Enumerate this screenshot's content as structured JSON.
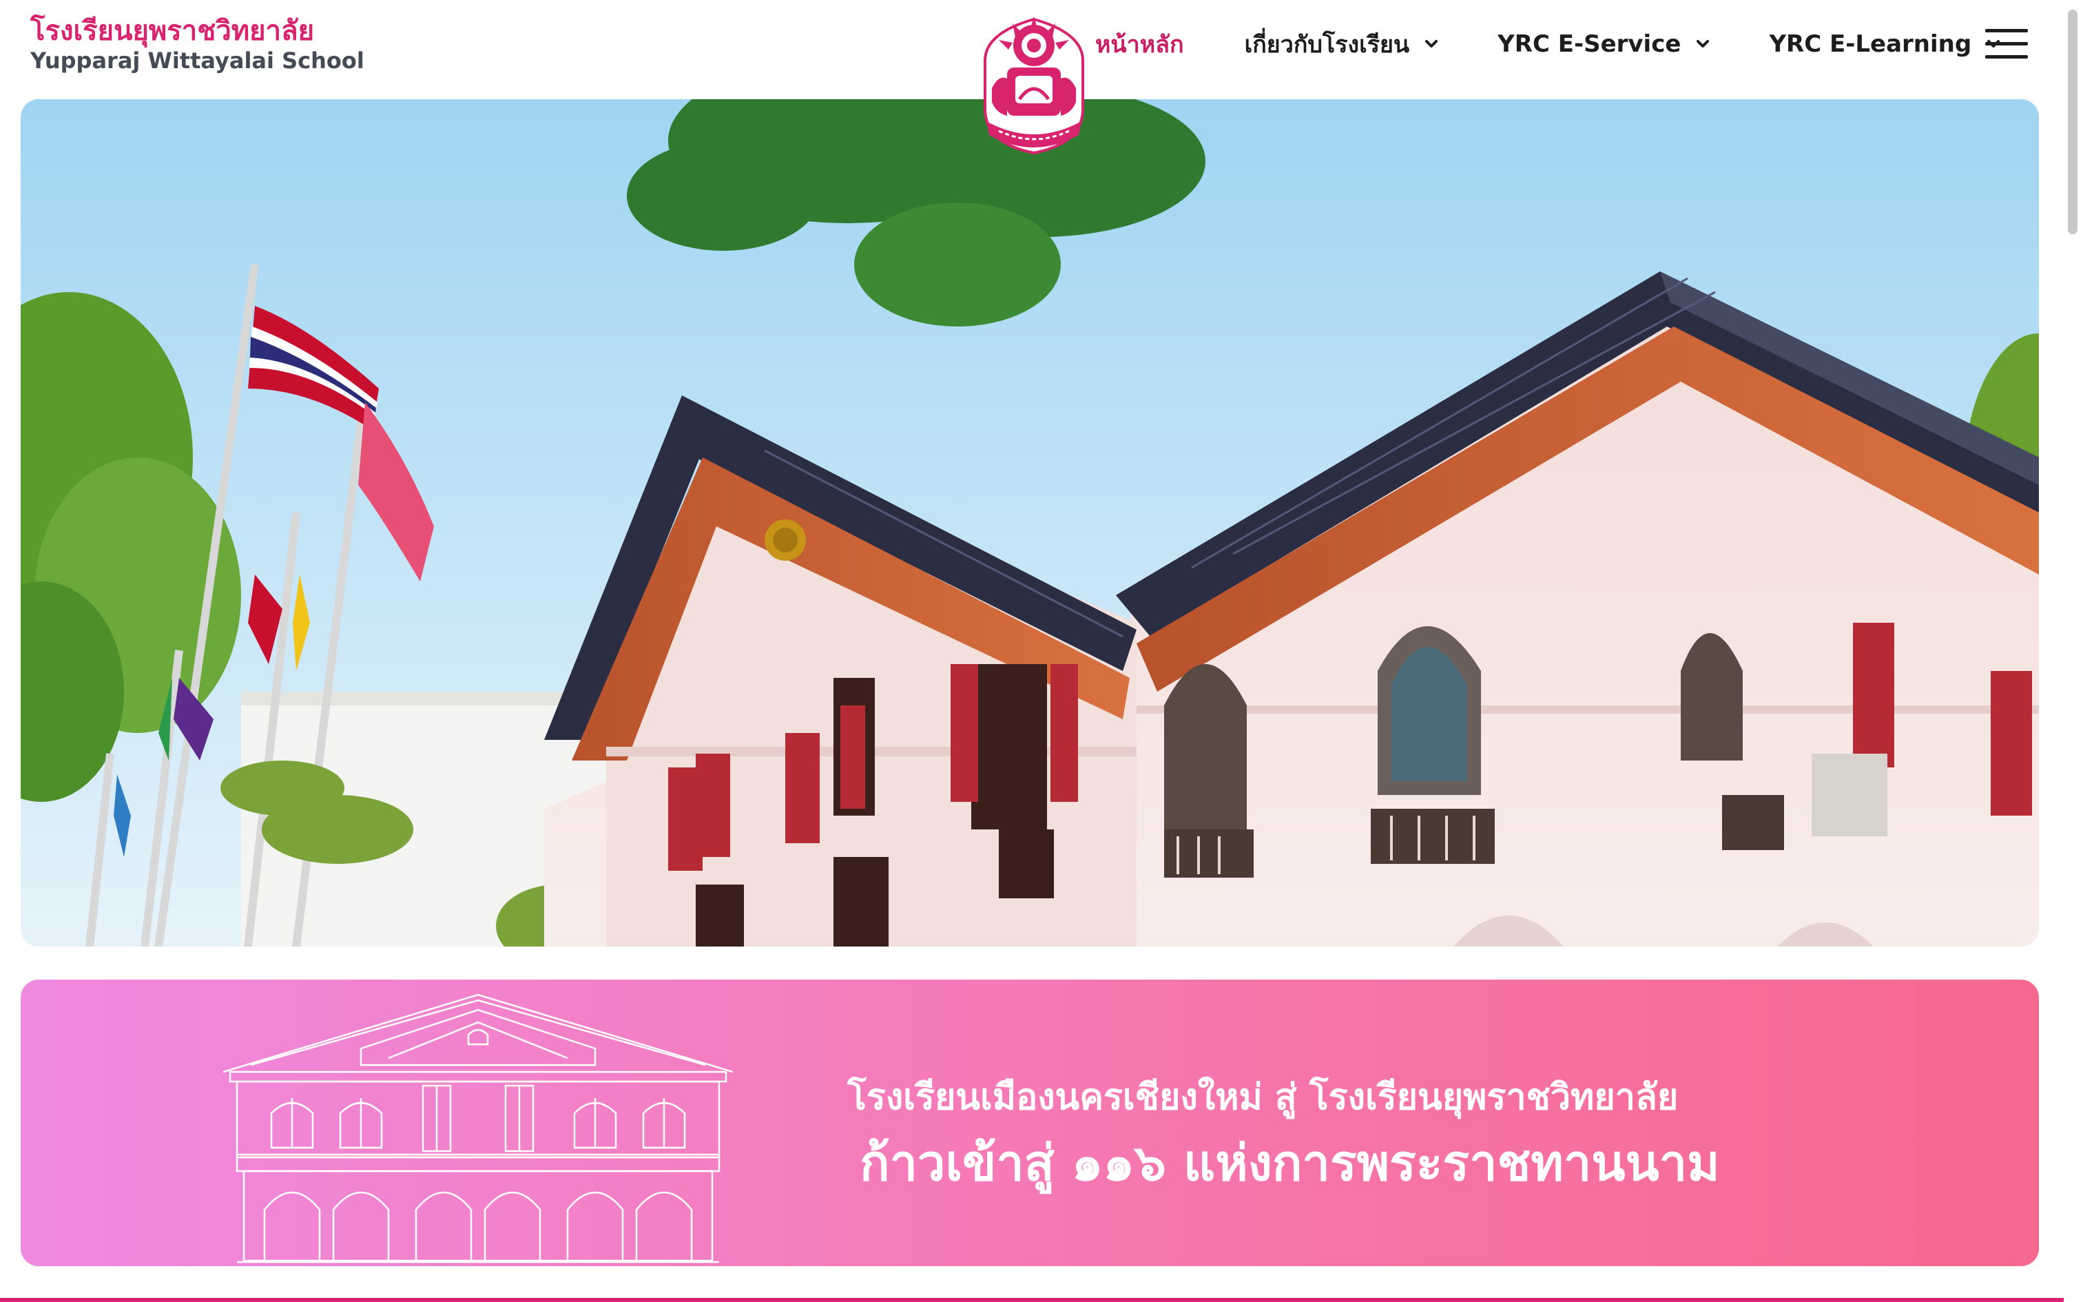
{
  "brand": {
    "thai_name": "โรงเรียนยุพราชวิทยาลัย",
    "english_name": "Yupparaj Wittayalai School"
  },
  "nav": {
    "items": [
      {
        "label": "หน้าหลัก",
        "active": true
      },
      {
        "label": "เกี่ยวกับโรงเรียน",
        "has_dropdown": true
      },
      {
        "label": "YRC E-Service",
        "has_dropdown": true
      },
      {
        "label": "YRC E-Learning",
        "has_dropdown": true
      }
    ],
    "menu_icon": "hamburger-menu-icon"
  },
  "emblem": {
    "icon": "school-emblem"
  },
  "banner": {
    "line1": "โรงเรียนเมืองนครเชียงใหม่ สู่ โรงเรียนยุพราชวิทยาลัย",
    "line2": "ก้าวเข้าสู่ ๑๑๖ แห่งการพระราชทานนาม"
  },
  "colors": {
    "brand_pink": "#d8246e",
    "banner_gradient_start": "#ee8ae0",
    "banner_gradient_end": "#f6688e",
    "nav_text": "#1d1d1f"
  }
}
